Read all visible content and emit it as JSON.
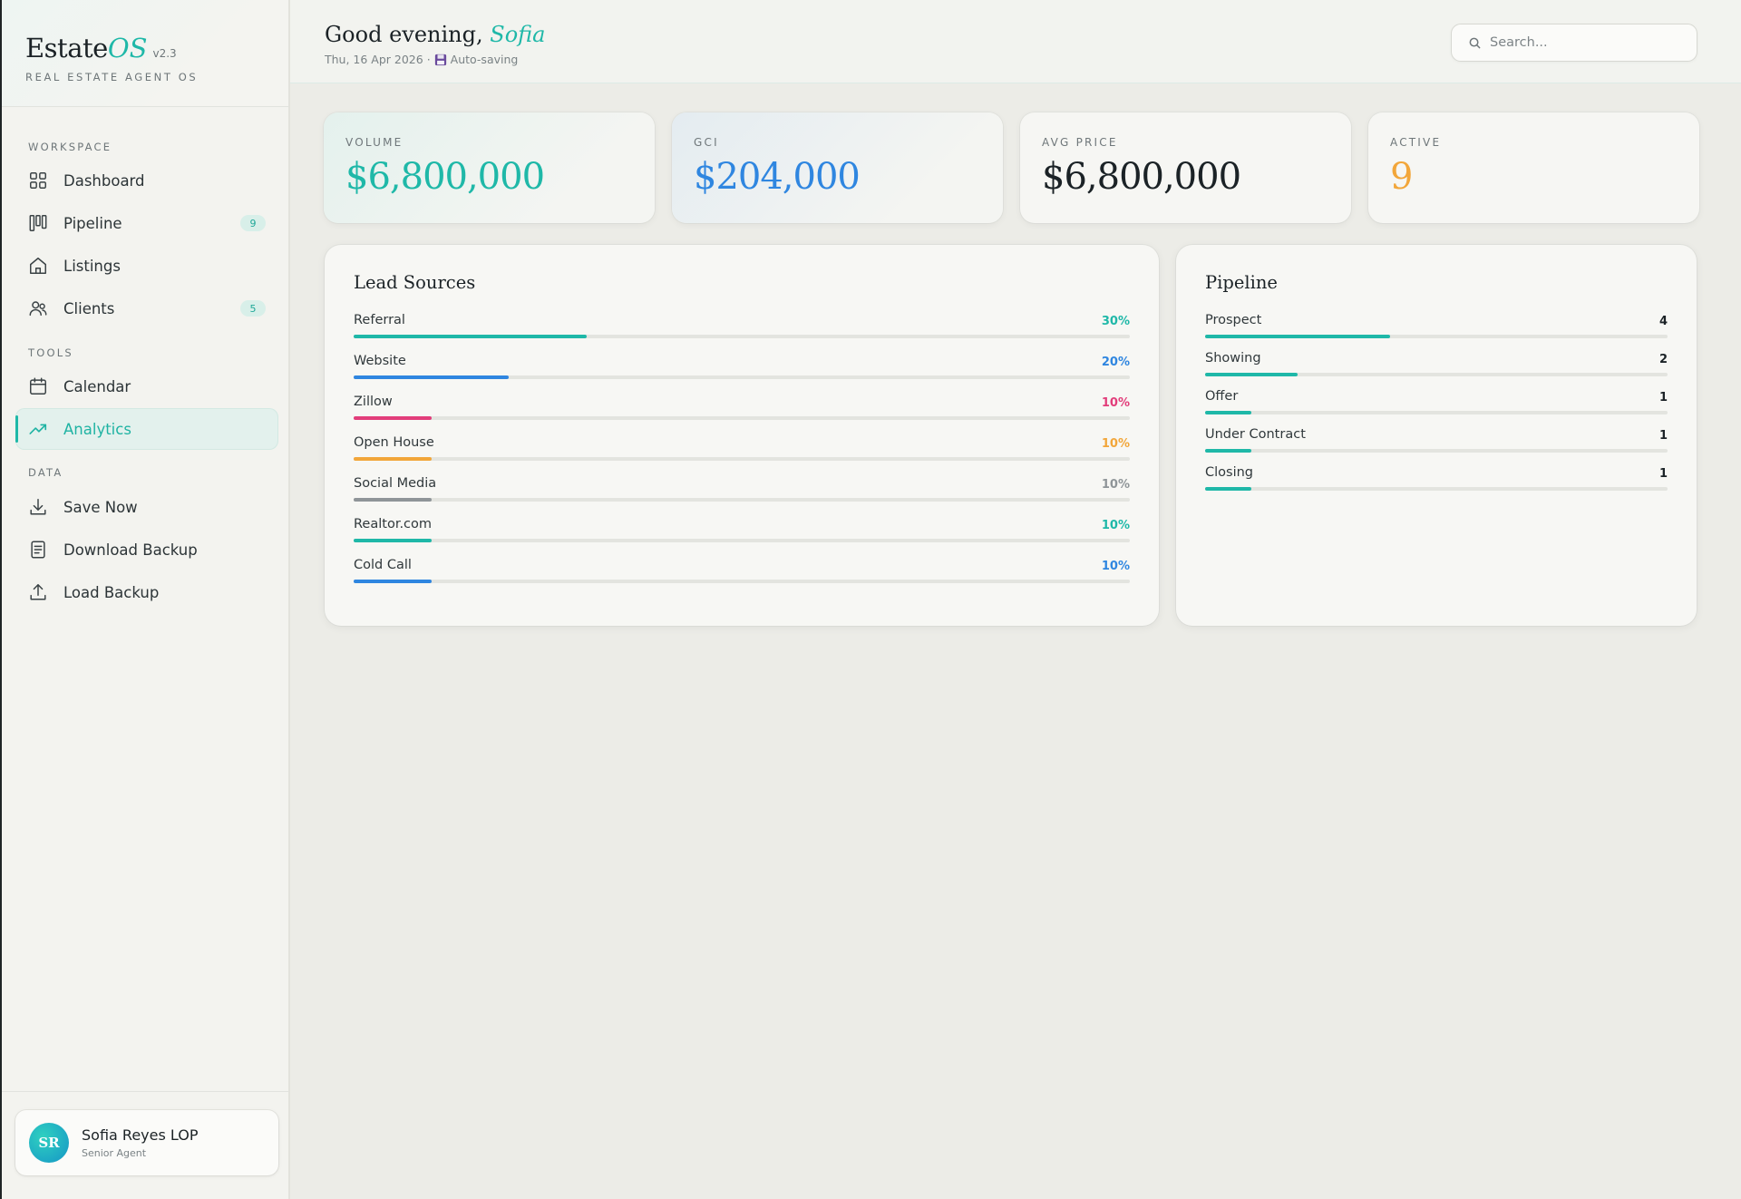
{
  "brand": {
    "name": "Estate",
    "accent": "OS",
    "version": "v2.3",
    "tagline": "REAL ESTATE AGENT OS"
  },
  "nav": {
    "workspace_label": "WORKSPACE",
    "tools_label": "TOOLS",
    "data_label": "DATA",
    "items": {
      "dashboard": {
        "label": "Dashboard",
        "icon": "grid-icon"
      },
      "pipeline": {
        "label": "Pipeline",
        "icon": "kanban-icon",
        "badge": "9"
      },
      "listings": {
        "label": "Listings",
        "icon": "home-icon"
      },
      "clients": {
        "label": "Clients",
        "icon": "users-icon",
        "badge": "5"
      },
      "calendar": {
        "label": "Calendar",
        "icon": "calendar-icon"
      },
      "analytics": {
        "label": "Analytics",
        "icon": "trend-icon",
        "active": true
      },
      "save_now": {
        "label": "Save Now",
        "icon": "download-icon"
      },
      "download_backup": {
        "label": "Download Backup",
        "icon": "document-icon"
      },
      "load_backup": {
        "label": "Load Backup",
        "icon": "upload-icon"
      }
    }
  },
  "user": {
    "initials": "SR",
    "name": "Sofia Reyes LOP",
    "role": "Senior Agent"
  },
  "header": {
    "greeting": "Good evening,",
    "name": "Sofia",
    "date": "Thu, 16 Apr 2026 · ",
    "status": "Auto-saving"
  },
  "search": {
    "placeholder": "Search...",
    "value": ""
  },
  "kpis": {
    "volume": {
      "label": "VOLUME",
      "value": "$6,800,000",
      "color": "#1fb8a8"
    },
    "gci": {
      "label": "GCI",
      "value": "$204,000",
      "color": "#2f86e0"
    },
    "avg_price": {
      "label": "AVG PRICE",
      "value": "$6,800,000",
      "color": "#1b2226"
    },
    "active": {
      "label": "ACTIVE",
      "value": "9",
      "color": "#f2a63a"
    }
  },
  "lead_sources": {
    "title": "Lead Sources",
    "rows": [
      {
        "label": "Referral",
        "value": "30%",
        "fraction": 0.3,
        "color": "#1fb8a8"
      },
      {
        "label": "Website",
        "value": "20%",
        "fraction": 0.2,
        "color": "#2f86e0"
      },
      {
        "label": "Zillow",
        "value": "10%",
        "fraction": 0.1,
        "color": "#e23d7a"
      },
      {
        "label": "Open House",
        "value": "10%",
        "fraction": 0.1,
        "color": "#f2a63a"
      },
      {
        "label": "Social Media",
        "value": "10%",
        "fraction": 0.1,
        "color": "#8f9598"
      },
      {
        "label": "Realtor.com",
        "value": "10%",
        "fraction": 0.1,
        "color": "#1fb8a8"
      },
      {
        "label": "Cold Call",
        "value": "10%",
        "fraction": 0.1,
        "color": "#2f86e0"
      }
    ]
  },
  "pipeline": {
    "title": "Pipeline",
    "rows": [
      {
        "label": "Prospect",
        "value": "4",
        "fraction": 0.4,
        "color": "#1fb8a8"
      },
      {
        "label": "Showing",
        "value": "2",
        "fraction": 0.2,
        "color": "#1fb8a8"
      },
      {
        "label": "Offer",
        "value": "1",
        "fraction": 0.1,
        "color": "#1fb8a8"
      },
      {
        "label": "Under Contract",
        "value": "1",
        "fraction": 0.1,
        "color": "#1fb8a8"
      },
      {
        "label": "Closing",
        "value": "1",
        "fraction": 0.1,
        "color": "#1fb8a8"
      }
    ]
  }
}
